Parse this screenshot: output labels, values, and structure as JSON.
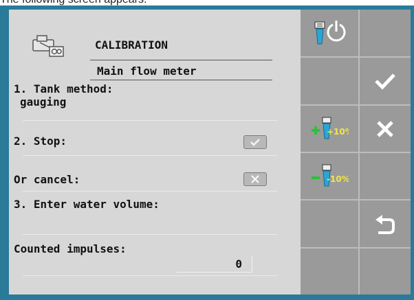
{
  "intro_text": "The following screen appears.",
  "screen": {
    "title": "CALIBRATION",
    "subtitle": "Main flow meter",
    "step1_line1": "1. Tank method:",
    "step1_line2": "gauging",
    "step2_label": "2. Stop:",
    "cancel_label": "Or cancel:",
    "step3_label": "3. Enter water volume:",
    "impulses_label": "Counted impulses:",
    "impulses_value": "0"
  },
  "softkeys": {
    "left": [
      "reset-power-icon",
      "",
      "plus-10-percent-icon",
      "minus-10-percent-icon",
      "",
      ""
    ],
    "right": [
      "",
      "confirm-check-icon",
      "cancel-x-icon",
      "",
      "back-return-icon",
      ""
    ],
    "plus_label": "+10%",
    "minus_label": "-10%"
  },
  "colors": {
    "frame": "#2a7a9a",
    "panel": "#d7d7d7",
    "softkey_bg": "#9a9a9a"
  }
}
